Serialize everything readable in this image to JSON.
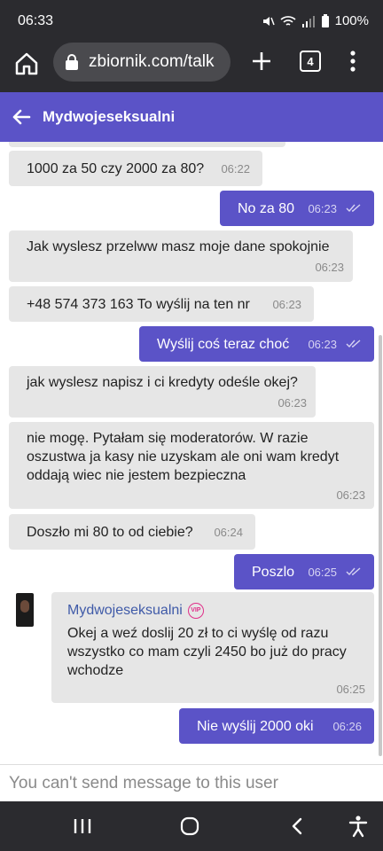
{
  "status": {
    "time": "06:33",
    "battery": "100%"
  },
  "browser": {
    "url": "zbiornik.com/talk",
    "tab_count": "4"
  },
  "header": {
    "title": "Mydwojeseksualni"
  },
  "messages": [
    {
      "text": "1000 za 50 czy 2000 za 80?",
      "time": "06:22"
    },
    {
      "text": "No za 80",
      "time": "06:23"
    },
    {
      "text": "Jak wyslesz przelww masz moje dane spokojnie",
      "time": "06:23"
    },
    {
      "text": "+48 574 373 163 To wyślij na ten nr",
      "time": "06:23"
    },
    {
      "text": "Wyślij coś teraz choć",
      "time": "06:23"
    },
    {
      "text": "jak wyslesz napisz i ci kredyty odeśle okej?",
      "time": "06:23"
    },
    {
      "line1": "nie mogę. Pytałam się moderatorów. W razie",
      "line2": "oszustwa ja kasy nie uzyskam ale oni wam kredyt",
      "line3": "oddają wiec nie jestem bezpieczna",
      "time": "06:23"
    },
    {
      "text": "Doszło mi 80 to od ciebie?",
      "time": "06:24"
    },
    {
      "text": "Poszlo",
      "time": "06:25"
    },
    {
      "sender": "Mydwojeseksualni",
      "badge": "VIP",
      "line1": "Okej a weź doslij 20 zł to ci wyślę od razu",
      "line2": "wszystko co mam czyli 2450 bo już do pracy",
      "line3": "wchodze",
      "time": "06:25"
    },
    {
      "text": "Nie wyślij 2000 oki",
      "time": "06:26"
    }
  ],
  "input": {
    "placeholder": "You can't send message to this user"
  },
  "colors": {
    "accent": "#5b53c7",
    "incoming": "#e6e6e6",
    "vip": "#e0308a"
  }
}
